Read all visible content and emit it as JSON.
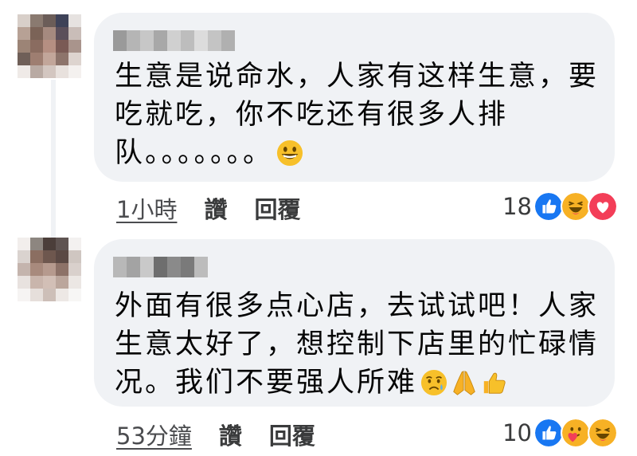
{
  "comments": [
    {
      "text_lines": [
        "生意是说命水，人家有这样生意，要",
        "吃就吃，你不吃还有很多人排",
        "队。。。。。。。"
      ],
      "emojis": [
        "grinning-face"
      ],
      "time": "1小時",
      "like_label": "讚",
      "reply_label": "回覆",
      "reaction_count": "18",
      "reactions": [
        "like",
        "haha",
        "love"
      ]
    },
    {
      "text_lines": [
        "外面有很多点心店，去试试吧！人家",
        "生意太好了，想控制下店里的忙碌情",
        "况。我们不要强人所难"
      ],
      "emojis": [
        "sad-relieved-face",
        "folded-hands",
        "thumbs-up"
      ],
      "time": "53分鐘",
      "like_label": "讚",
      "reply_label": "回覆",
      "reaction_count": "10",
      "reactions": [
        "like",
        "care",
        "haha"
      ]
    }
  ],
  "colors": {
    "bubble": "#f0f2f5",
    "like_blue": "#1877f2",
    "love_red": "#f33e58",
    "haha_yellow": "#f7b125"
  }
}
